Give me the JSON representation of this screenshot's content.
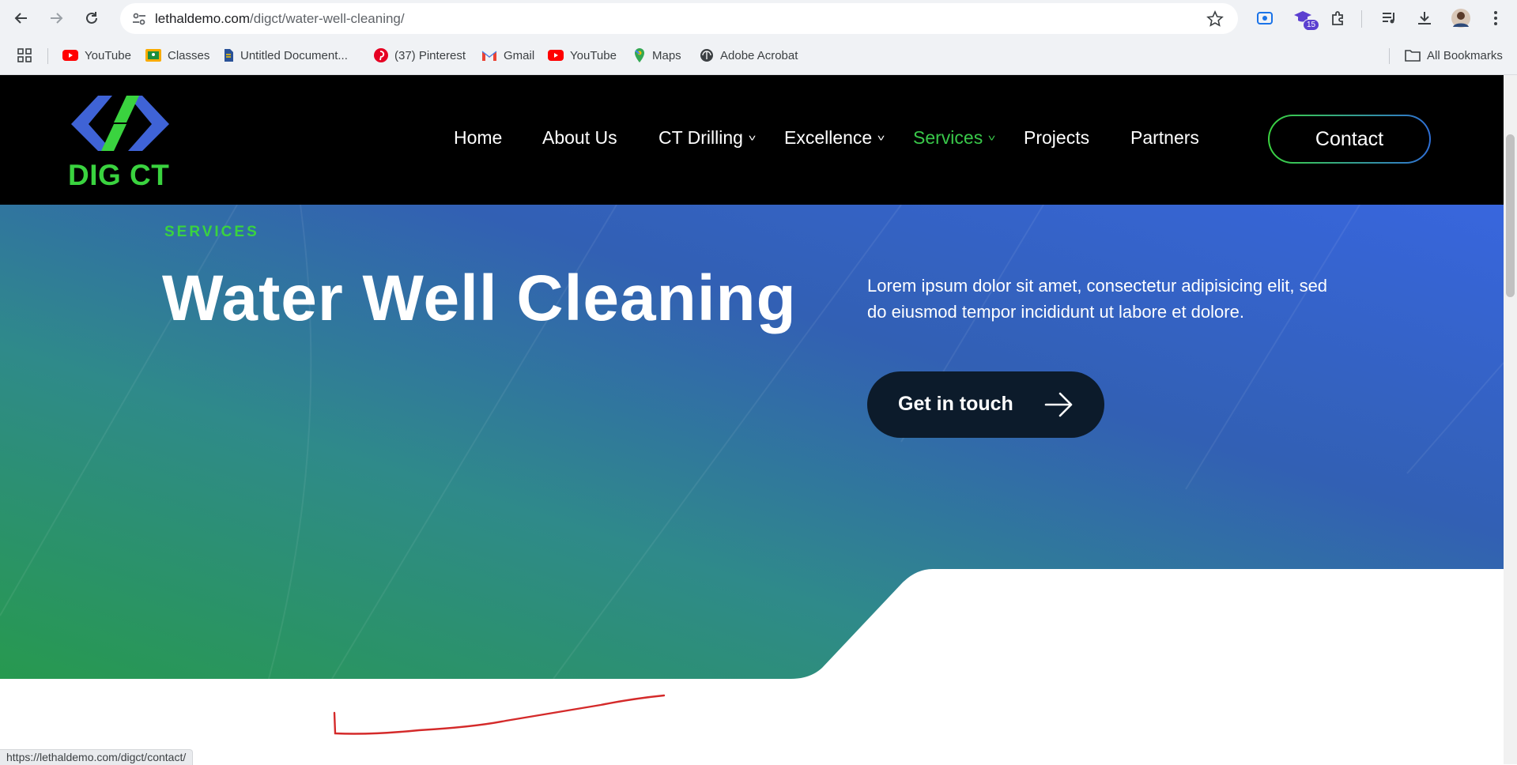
{
  "browser": {
    "url_host": "lethaldemo.com",
    "url_path": "/digct/water-well-cleaning/",
    "extension_badge": "15",
    "bookmarks": [
      {
        "label": "YouTube",
        "icon": "youtube-icon"
      },
      {
        "label": "Classes",
        "icon": "classes-icon"
      },
      {
        "label": "Untitled Document...",
        "icon": "document-icon"
      },
      {
        "label": "(37) Pinterest",
        "icon": "pinterest-icon"
      },
      {
        "label": "Gmail",
        "icon": "gmail-icon"
      },
      {
        "label": "YouTube",
        "icon": "youtube-icon"
      },
      {
        "label": "Maps",
        "icon": "maps-icon"
      },
      {
        "label": "Adobe Acrobat",
        "icon": "acrobat-icon"
      }
    ],
    "all_bookmarks": "All Bookmarks",
    "status_url": "https://lethaldemo.com/digct/contact/"
  },
  "site": {
    "logo_text": "DIG CT",
    "menu": [
      {
        "label": "Home",
        "dropdown": false,
        "active": false
      },
      {
        "label": "About Us",
        "dropdown": false,
        "active": false
      },
      {
        "label": "CT Drilling",
        "dropdown": true,
        "active": false
      },
      {
        "label": "Excellence",
        "dropdown": true,
        "active": false
      },
      {
        "label": "Services",
        "dropdown": true,
        "active": true
      },
      {
        "label": "Projects",
        "dropdown": false,
        "active": false
      },
      {
        "label": "Partners",
        "dropdown": false,
        "active": false
      }
    ],
    "contact_label": "Contact"
  },
  "hero": {
    "eyebrow": "SERVICES",
    "title": "Water Well Cleaning",
    "description": "Lorem ipsum dolor sit amet, consectetur adipisicing elit, sed do eiusmod tempor incididunt ut labore et dolore.",
    "cta_label": "Get in touch"
  },
  "colors": {
    "accent_green": "#3ad33f",
    "hero_blue": "#3463d1",
    "cta_bg": "#0c1b2b",
    "annotation_red": "#d42a2a"
  }
}
